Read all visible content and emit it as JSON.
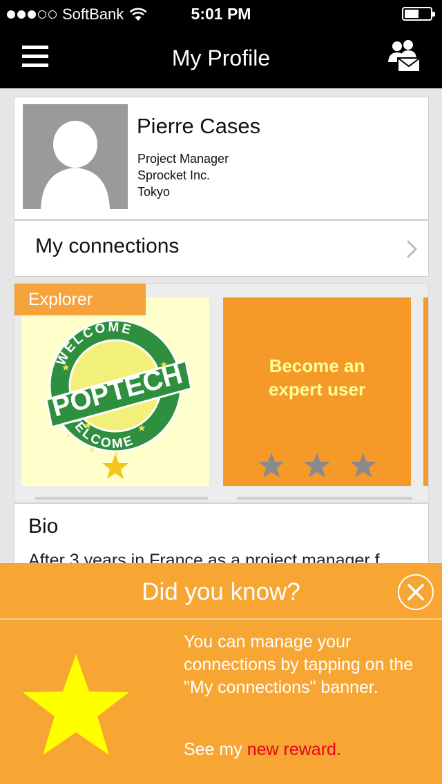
{
  "status_bar": {
    "carrier": "SoftBank",
    "time": "5:01 PM"
  },
  "nav": {
    "title": "My Profile"
  },
  "profile": {
    "name": "Pierre Cases",
    "role": "Project Manager",
    "company": "Sprocket Inc.",
    "location": "Tokyo"
  },
  "connections": {
    "label": "My connections"
  },
  "badges": {
    "explorer_label": "Explorer",
    "poptech_logo_text": {
      "top": "WELCOME",
      "center": "POPTECH",
      "bottom": "WELCOME"
    },
    "expert": {
      "line1": "Become an",
      "line2": "expert user"
    },
    "explorer_stars": 1,
    "expert_stars_earned": 0,
    "expert_stars_total": 3,
    "colors": {
      "explorer_bg": "#ffffcc",
      "expert_bg": "#f59a28",
      "star_gold": "#f5c518",
      "star_gray": "#8a8a8a"
    }
  },
  "bio": {
    "heading": "Bio",
    "text": "After 3 years in France as a project manager f"
  },
  "tip": {
    "title": "Did you know?",
    "body": "You can manage your connections by tapping on the \"My connections\" banner.",
    "reward_prefix": "See my",
    "reward_link": "new reward.",
    "colors": {
      "background": "#f7a634",
      "link": "#e8001c",
      "star": "#ffff00"
    }
  }
}
